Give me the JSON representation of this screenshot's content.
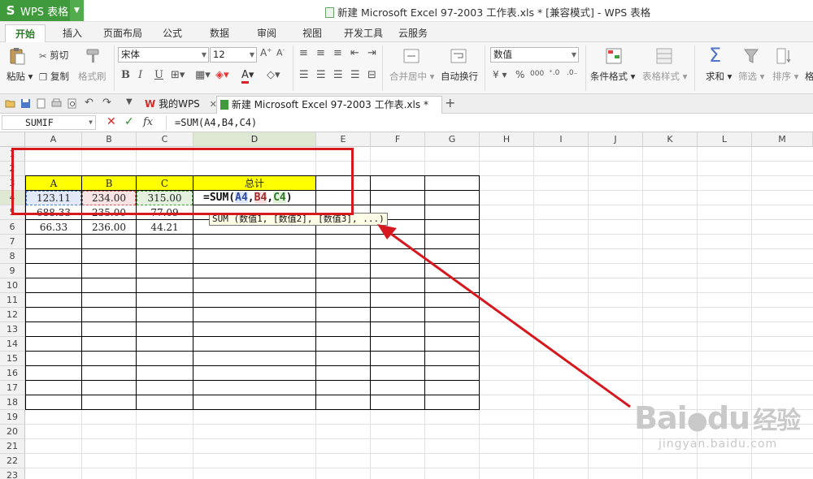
{
  "app": {
    "name": "WPS 表格",
    "logo_letter": "S",
    "window_title": "新建 Microsoft Excel 97-2003 工作表.xls * [兼容模式] - WPS 表格"
  },
  "ribbon_tabs": [
    "开始",
    "插入",
    "页面布局",
    "公式",
    "数据",
    "审阅",
    "视图",
    "开发工具",
    "云服务"
  ],
  "ribbon": {
    "paste": "粘贴",
    "cut": "剪切",
    "copy": "复制",
    "format_painter": "格式刷",
    "font_name": "宋体",
    "font_size": "12",
    "bold": "B",
    "italic": "I",
    "underline": "U",
    "merge_center": "合并居中",
    "wrap_text": "自动换行",
    "number_format": "数值",
    "currency_sign": "¥",
    "percent": "%",
    "comma": "000",
    "conditional_format": "条件格式",
    "table_style": "表格样式",
    "sum": "求和",
    "filter": "筛选",
    "sort": "排序",
    "format_partial": "格"
  },
  "doc_tabs": {
    "home": "我的WPS",
    "file": "新建 Microsoft Excel 97-2003 工作表.xls *"
  },
  "formula_bar": {
    "name_box": "SUMIF",
    "fx": "fx",
    "formula": "=SUM(A4,B4,C4)"
  },
  "columns": [
    "A",
    "B",
    "C",
    "D",
    "E",
    "F",
    "G",
    "H",
    "I",
    "J",
    "K",
    "L",
    "M"
  ],
  "rows": [
    "1",
    "2",
    "3",
    "4",
    "5",
    "6",
    "7",
    "8",
    "9",
    "10",
    "11",
    "12",
    "13",
    "14",
    "15",
    "16",
    "17",
    "18",
    "19",
    "20",
    "21",
    "22",
    "23"
  ],
  "sheet": {
    "headers": [
      "A",
      "B",
      "C",
      "总计"
    ],
    "row4": [
      "123.11",
      "234.00",
      "315.00"
    ],
    "row5": [
      "688.33",
      "235.00",
      "77.09"
    ],
    "row6": [
      "66.33",
      "236.00",
      "44.21"
    ],
    "editing": {
      "prefix": "=SUM(",
      "ref1": "A4",
      "ref2": "B4",
      "ref3": "C4",
      "suffix": ")"
    },
    "tooltip": "SUM (数值1, [数值2], [数值3], ...)"
  },
  "watermark": {
    "brand": "Bai",
    "brand2": "du",
    "cn": "经验",
    "url": "jingyan.baidu.com"
  },
  "colors": {
    "wps_green": "#3e9a3a",
    "highlight_yellow": "#ffff00",
    "annotation_red": "#d5191f"
  }
}
